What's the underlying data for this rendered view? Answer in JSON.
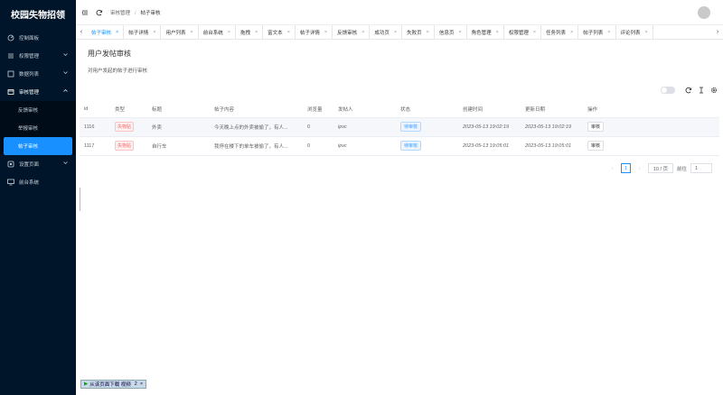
{
  "app": {
    "title": "校园失物招领"
  },
  "sidebar": {
    "items": [
      {
        "label": "控制面板",
        "icon": "dashboard-icon"
      },
      {
        "label": "权限管理",
        "icon": "sliders-icon"
      },
      {
        "label": "数据列表",
        "icon": "list-icon"
      },
      {
        "label": "审核管理",
        "icon": "audit-icon"
      },
      {
        "label": "设置页面",
        "icon": "settings-icon"
      },
      {
        "label": "前台系统",
        "icon": "monitor-icon"
      }
    ],
    "submenu": [
      {
        "label": "反馈审核"
      },
      {
        "label": "举报审核"
      },
      {
        "label": "帖子审核"
      }
    ]
  },
  "breadcrumb": {
    "parent": "审核管理",
    "separator": "/",
    "current": "帖子审核"
  },
  "tabs": [
    {
      "label": "帖子审核"
    },
    {
      "label": "帖子详情"
    },
    {
      "label": "用户列表"
    },
    {
      "label": "前台系统"
    },
    {
      "label": "拖拽"
    },
    {
      "label": "富文本"
    },
    {
      "label": "帖子详情"
    },
    {
      "label": "反馈审核"
    },
    {
      "label": "成功页"
    },
    {
      "label": "失败页"
    },
    {
      "label": "信息页"
    },
    {
      "label": "角色管理"
    },
    {
      "label": "权限管理"
    },
    {
      "label": "任务列表"
    },
    {
      "label": "帖子列表"
    },
    {
      "label": "评论列表"
    }
  ],
  "page": {
    "title": "用户发帖审核",
    "description": "对用户发起的帖子进行审核"
  },
  "table": {
    "headers": [
      "id",
      "类型",
      "标题",
      "帖子内容",
      "浏览量",
      "发帖人",
      "状态",
      "创建时间",
      "更新日期",
      "操作"
    ],
    "rows": [
      {
        "id": "1116",
        "type": "失物贴",
        "title": "外卖",
        "content": "今天晚上点的外卖被偷了，有人...",
        "views": "0",
        "author": "ipvc",
        "status": "待审核",
        "created": "2023-05-13 19:02:19",
        "updated": "2023-05-13 19:02:19",
        "action": "审核"
      },
      {
        "id": "1117",
        "type": "失物贴",
        "title": "自行车",
        "content": "我停在楼下的单车被偷了，有人...",
        "views": "0",
        "author": "ipvc",
        "status": "待审核",
        "created": "2023-05-13 19:05:01",
        "updated": "2023-05-13 19:05:01",
        "action": "审核"
      }
    ]
  },
  "pagination": {
    "current": "1",
    "page_size": "10 / 页",
    "goto_label": "前往",
    "goto_value": "1"
  },
  "download_bar": {
    "label": "从该页面下载 视频",
    "count": "2",
    "close": "×"
  },
  "colors": {
    "sidebar_bg": "#001529",
    "accent": "#1890ff",
    "tag_red": "#f56c6c",
    "tag_blue": "#409eff"
  }
}
